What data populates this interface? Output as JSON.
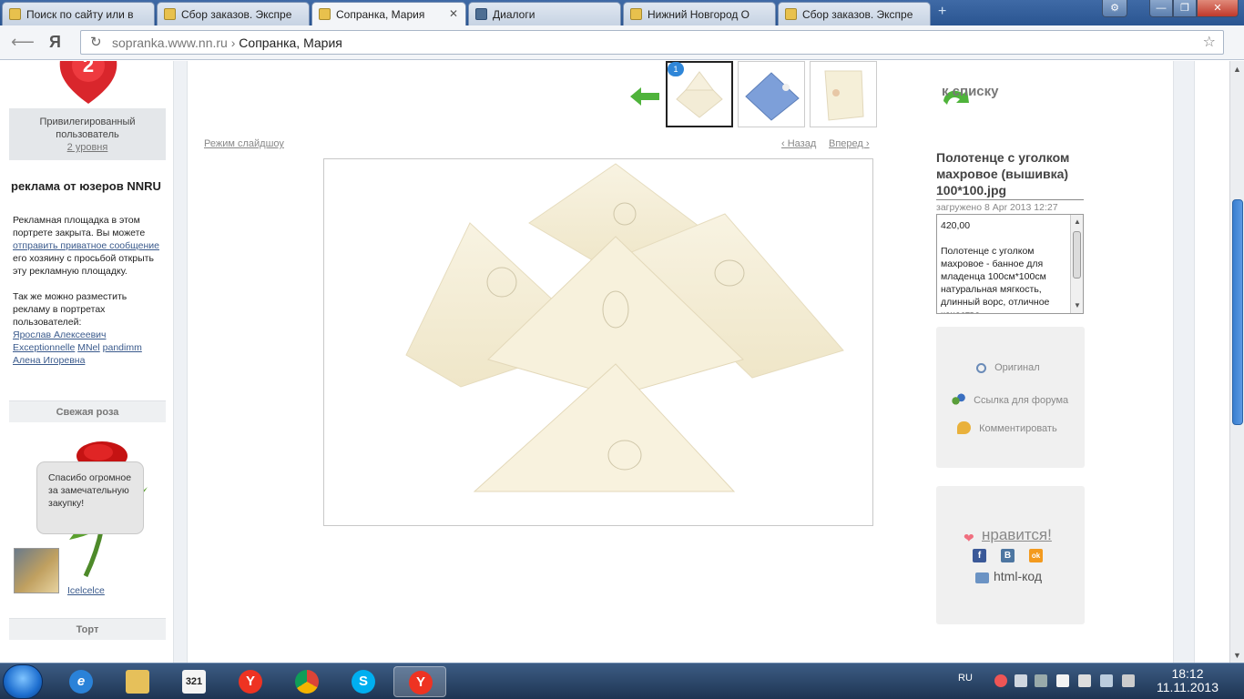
{
  "tabs": [
    {
      "label": "Поиск по сайту или в"
    },
    {
      "label": "Сбор заказов. Экспре"
    },
    {
      "label": "Сопранка, Мария"
    },
    {
      "label": "Диалоги"
    },
    {
      "label": "Нижний Новгород О"
    },
    {
      "label": "Сбор заказов. Экспре"
    }
  ],
  "newtab": "+",
  "window": {
    "settings": "⚙",
    "minimize": "—",
    "maximize": "❐",
    "close": "✕"
  },
  "address": {
    "browser_logo": "Я",
    "host": "sopranka.www.nn.ru",
    "separator": "›",
    "page_title": "Сопранка, Мария"
  },
  "sidebar": {
    "badge_number": "2",
    "privilege_line1": "Привилегированный",
    "privilege_line2": "пользователь",
    "privilege_level": "2 уровня",
    "ad_title": "реклама от юзеров NNRU",
    "ad_text1": "Рекламная площадка в этом портрете закрыта. Вы можете",
    "ad_link1": "отправить приватное сообщение",
    "ad_text2": "его хозяину с просьбой открыть эту рекламную площадку.",
    "ad_text3": "Так же можно разместить рекламу в портретах пользователей:",
    "ad_users": [
      "Ярослав Алексеевич",
      "Exceptionnelle",
      "MNel",
      "pandimm",
      "Алена Игоревна"
    ],
    "fresh_rose_title": "Свежая роза",
    "rose_comment": "Спасибо огромное за замечательную закупку!",
    "rose_user": "Icelcelce",
    "cake_title": "Торт"
  },
  "gallery": {
    "thumb_badge": "1",
    "to_list": "к списку",
    "slideshow": "Режим слайдшоу",
    "prev": "‹ Назад",
    "next": "Вперед ›"
  },
  "photo": {
    "title": "Полотенце с уголком махровое (вышивка) 100*100.jpg",
    "uploaded": "загружено 8 Apr 2013 12:27",
    "description": "420,00\n\nПолотенце с уголком махровое - банное для младенца 100см*100см натуральная мягкость, длинный ворс, отличное качество"
  },
  "actions": {
    "original": "Оригинал",
    "forum_link": "Ссылка для форума",
    "comment": "Комментировать"
  },
  "like": {
    "label": "нравится!",
    "html_code": "html-код",
    "fb": "f",
    "vk": "В",
    "ok": "ok"
  },
  "taskbar": {
    "lang": "RU",
    "time": "18:12",
    "date": "11.11.2013",
    "player_label": "321"
  }
}
